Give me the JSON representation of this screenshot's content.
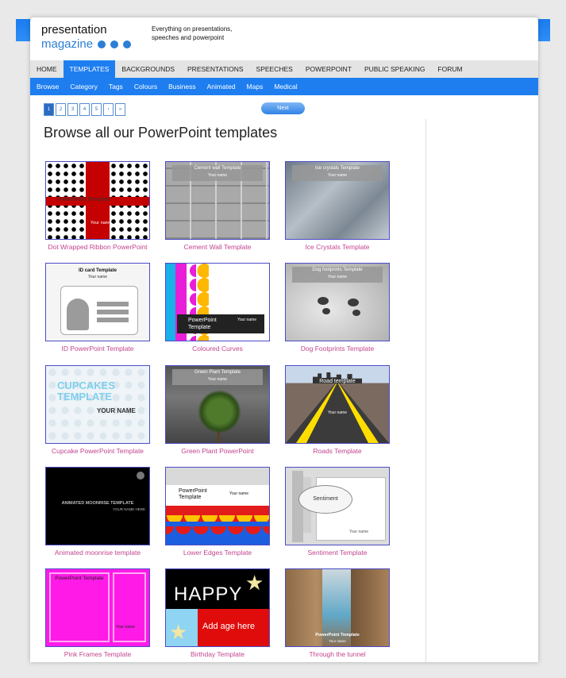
{
  "site": {
    "logo_line1": "presentation",
    "logo_line2": "magazine",
    "tagline": "Everything on presentations, speeches and powerpoint"
  },
  "nav": [
    "HOME",
    "TEMPLATES",
    "BACKGROUNDS",
    "PRESENTATIONS",
    "SPEECHES",
    "POWERPOINT",
    "PUBLIC SPEAKING",
    "FORUM"
  ],
  "nav_active": "TEMPLATES",
  "subnav": [
    "Browse",
    "Category",
    "Tags",
    "Colours",
    "Business",
    "Animated",
    "Maps",
    "Medical"
  ],
  "pager": {
    "pages": [
      "1",
      "2",
      "3",
      "4",
      "5",
      "›",
      "»"
    ],
    "current": "1",
    "next_label": "Next"
  },
  "heading": "Browse all our PowerPoint templates",
  "templates": [
    {
      "caption": "Dot Wrapped Ribbon PowerPoint",
      "thumb_title": "PowerPoint Template",
      "thumb_sub": "Your name"
    },
    {
      "caption": "Cement Wall Template",
      "thumb_title": "Cement wall Template",
      "thumb_sub": "Your name"
    },
    {
      "caption": "Ice Crystals Template",
      "thumb_title": "Ice crystals Template",
      "thumb_sub": "Your name"
    },
    {
      "caption": "ID PowerPoint Template",
      "thumb_title": "ID card Template",
      "thumb_sub": "Your name"
    },
    {
      "caption": "Coloured Curves",
      "thumb_title": "PowerPoint Template",
      "thumb_sub": "Your name"
    },
    {
      "caption": "Dog Footprints Template",
      "thumb_title": "Dog footprints Template",
      "thumb_sub": "Your name"
    },
    {
      "caption": "Cupcake PowerPoint Template",
      "thumb_title": "CUPCAKES TEMPLATE",
      "thumb_sub": "YOUR NAME"
    },
    {
      "caption": "Green Plant PowerPoint",
      "thumb_title": "Green Plant Template",
      "thumb_sub": "Your name"
    },
    {
      "caption": "Roads Template",
      "thumb_title": "Road template",
      "thumb_sub": "Your name"
    },
    {
      "caption": "Animated moonrise template",
      "thumb_title": "ANIMATED MOONRISE TEMPLATE",
      "thumb_sub": "YOUR NAME HERE"
    },
    {
      "caption": "Lower Edges Template",
      "thumb_title": "PowerPoint Template",
      "thumb_sub": "Your name"
    },
    {
      "caption": "Sentiment Template",
      "thumb_title": "Sentiment",
      "thumb_sub": "Your name"
    },
    {
      "caption": "Pink Frames Template",
      "thumb_title": "PowerPoint Template",
      "thumb_sub": "Your name"
    },
    {
      "caption": "Birthday Template",
      "thumb_title": "HAPPY",
      "thumb_sub": "Add age here"
    },
    {
      "caption": "Through the tunnel",
      "thumb_title": "PowerPoint Template",
      "thumb_sub": "Your name"
    }
  ],
  "colors": {
    "accent": "#1e7ef0",
    "caption": "#c2458f"
  }
}
